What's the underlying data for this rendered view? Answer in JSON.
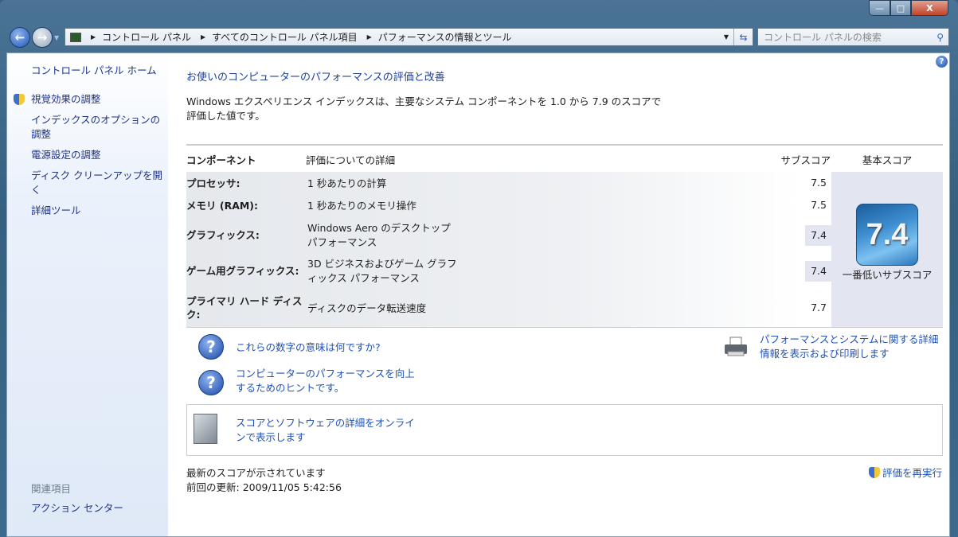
{
  "window": {
    "minimize": "—",
    "maximize": "□",
    "close": "X"
  },
  "address": {
    "crumbs": [
      "コントロール パネル",
      "すべてのコントロール パネル項目",
      "パフォーマンスの情報とツール"
    ]
  },
  "search": {
    "placeholder": "コントロール パネルの検索"
  },
  "sidebar": {
    "home": "コントロール パネル ホーム",
    "items": [
      "視覚効果の調整",
      "インデックスのオプションの調整",
      "電源設定の調整",
      "ディスク クリーンアップを開く",
      "詳細ツール"
    ],
    "related_header": "関連項目",
    "related": [
      "アクション センター"
    ]
  },
  "main": {
    "title": "お使いのコンピューターのパフォーマンスの評価と改善",
    "description": "Windows エクスペリエンス インデックスは、主要なシステム コンポーネントを 1.0 から 7.9 のスコアで評価した値です。",
    "headers": {
      "component": "コンポーネント",
      "details": "評価についての詳細",
      "subscore": "サブスコア",
      "basescore": "基本スコア"
    },
    "rows": [
      {
        "component": "プロセッサ:",
        "details": "1 秒あたりの計算",
        "score": "7.5"
      },
      {
        "component": "メモリ (RAM):",
        "details": "1 秒あたりのメモリ操作",
        "score": "7.5"
      },
      {
        "component": "グラフィックス:",
        "details": "Windows Aero のデスクトップ パフォーマンス",
        "score": "7.4"
      },
      {
        "component": "ゲーム用グラフィックス:",
        "details": "3D ビジネスおよびゲーム グラフィックス パフォーマンス",
        "score": "7.4"
      },
      {
        "component": "プライマリ ハード ディスク:",
        "details": "ディスクのデータ転送速度",
        "score": "7.7"
      }
    ],
    "base_score": "7.4",
    "base_caption": "一番低いサブスコア",
    "links": {
      "what_mean": "これらの数字の意味は何ですか?",
      "tips": "コンピューターのパフォーマンスを向上するためのヒントです。",
      "print": "パフォーマンスとシステムに関する詳細情報を表示および印刷します",
      "online": "スコアとソフトウェアの詳細をオンラインで表示します"
    },
    "status": "最新のスコアが示されています",
    "last_update_label": "前回の更新:",
    "last_update": "2009/11/05 5:42:56",
    "rerun": "評価を再実行"
  }
}
